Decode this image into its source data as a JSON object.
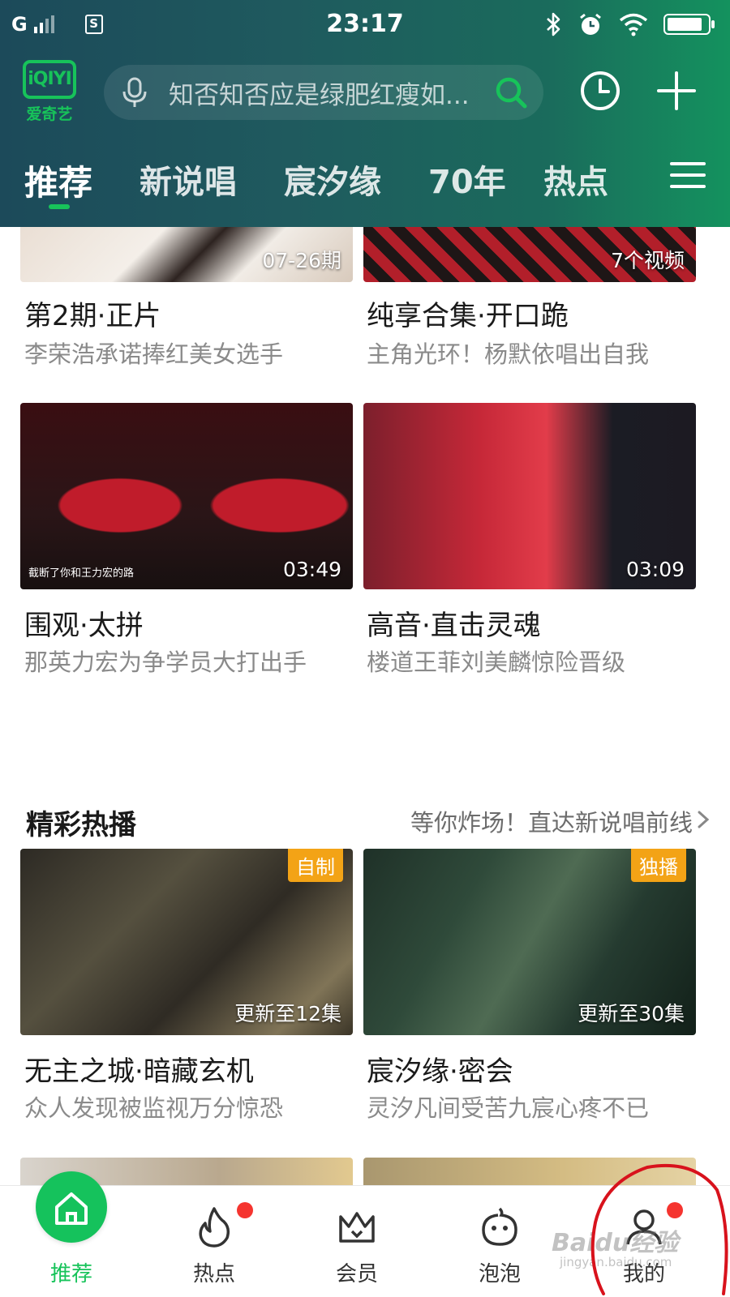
{
  "status_bar": {
    "carrier": "G",
    "sim_label": "S",
    "time": "23:17"
  },
  "header": {
    "logo_box_text": "iQIYI",
    "logo_text": "爱奇艺",
    "search_placeholder": "知否知否应是绿肥红瘦如...",
    "tabs": [
      "推荐",
      "新说唱",
      "宸汐缘",
      "70年",
      "热点"
    ]
  },
  "feed_top": [
    {
      "overlay": "07-26期",
      "title": "第2期·正片",
      "subtitle": "李荣浩承诺捧红美女选手"
    },
    {
      "overlay": "7个视频",
      "title": "纯享合集·开口跪",
      "subtitle": "主角光环！杨默依唱出自我"
    },
    {
      "overlay": "03:49",
      "caption": "截断了你和王力宏的路",
      "title": "围观·太拼",
      "subtitle": "那英力宏为争学员大打出手"
    },
    {
      "overlay": "03:09",
      "title": "高音·直击灵魂",
      "subtitle": "楼道王菲刘美麟惊险晋级"
    }
  ],
  "section": {
    "title": "精彩热播",
    "link": "等你炸场！直达新说唱前线"
  },
  "feed_hot": [
    {
      "badge": "自制",
      "overlay": "更新至12集",
      "title": "无主之城·暗藏玄机",
      "subtitle": "众人发现被监视万分惊恐"
    },
    {
      "badge": "独播",
      "overlay": "更新至30集",
      "title": "宸汐缘·密会",
      "subtitle": "灵汐凡间受苦九宸心疼不已"
    }
  ],
  "bottom_nav": [
    {
      "label": "推荐",
      "icon": "home-icon",
      "active": true
    },
    {
      "label": "热点",
      "icon": "flame-icon",
      "dot": true
    },
    {
      "label": "会员",
      "icon": "crown-icon"
    },
    {
      "label": "泡泡",
      "icon": "bubble-face-icon"
    },
    {
      "label": "我的",
      "icon": "user-icon",
      "dot": true
    }
  ],
  "watermark": {
    "text": "Baidu经验",
    "sub": "jingyan.baidu.com"
  },
  "colors": {
    "brand_green": "#17c35a",
    "badge_orange": "#f3a316",
    "notify_red": "#f5342f"
  }
}
